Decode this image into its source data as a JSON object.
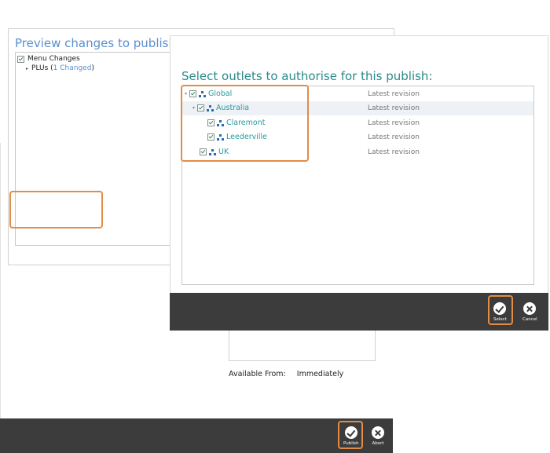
{
  "preview": {
    "title": "Preview changes to publish:",
    "tree": {
      "menu_changes": "Menu Changes",
      "plus_label": "PLUs (",
      "plus_changed": "1 Changed",
      "plus_close": ")"
    },
    "available_label": "Available From:",
    "available_value": "Immediately",
    "publish_label": "Publish",
    "abort_label": "Abort"
  },
  "outlets": {
    "title": "Select outlets to authorise for this publish:",
    "rows": [
      {
        "name": "Global",
        "revision": "Latest revision",
        "checked": true,
        "expanded": true
      },
      {
        "name": "Australia",
        "revision": "Latest revision",
        "checked": true,
        "expanded": true,
        "selected": true
      },
      {
        "name": "Claremont",
        "revision": "Latest revision",
        "checked": true
      },
      {
        "name": "Leederville",
        "revision": "Latest revision",
        "checked": true
      },
      {
        "name": "UK",
        "revision": "Latest revision",
        "checked": true
      }
    ],
    "select_label": "Select",
    "cancel_label": "Cancel"
  },
  "colors": {
    "highlight": "#e28c45",
    "footer": "#3c3c3c",
    "title_blue": "#5b8fcf",
    "title_teal": "#2a8a8a"
  },
  "icons": [
    "checkbox-icon",
    "expand-arrow-icon",
    "org-hierarchy-icon",
    "check-circle-icon",
    "close-circle-icon"
  ]
}
